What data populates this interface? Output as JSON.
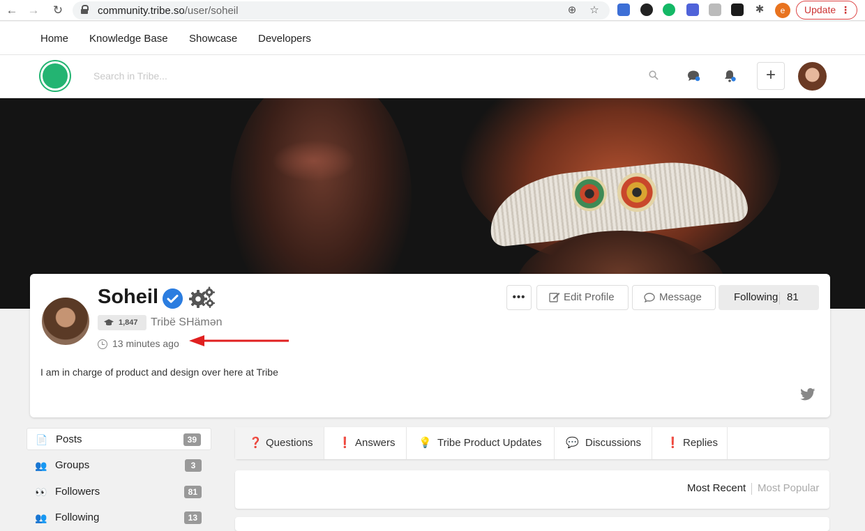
{
  "browser": {
    "url_host": "community.tribe.so",
    "url_path": "/user/soheil",
    "profile_initial": "e",
    "update_label": "Update",
    "update_menu": "⋮"
  },
  "site_nav": {
    "items": [
      {
        "label": "Home"
      },
      {
        "label": "Knowledge Base"
      },
      {
        "label": "Showcase"
      },
      {
        "label": "Developers"
      }
    ]
  },
  "header": {
    "search_placeholder": "Search in Tribe...",
    "add_label": "+"
  },
  "profile": {
    "name": "Soheil",
    "reputation": "1,847",
    "title": "Tribë SHämən",
    "last_seen": "13 minutes ago",
    "bio": "I am in charge of product and design over here at Tribe",
    "more_label": "•••",
    "edit_label": "Edit Profile",
    "message_label": "Message",
    "following_label": "Following",
    "following_count": "81"
  },
  "sidebar": {
    "items": [
      {
        "label": "Posts",
        "count": "39",
        "icon": "📄"
      },
      {
        "label": "Groups",
        "count": "3",
        "icon": "👥"
      },
      {
        "label": "Followers",
        "count": "81",
        "icon": "👀"
      },
      {
        "label": "Following",
        "count": "13",
        "icon": "👥"
      }
    ]
  },
  "tabs": {
    "items": [
      {
        "label": "Questions",
        "icon": "❓"
      },
      {
        "label": "Answers",
        "icon": "❗"
      },
      {
        "label": "Tribe Product Updates",
        "icon": "💡"
      },
      {
        "label": "Discussions",
        "icon": "💬"
      },
      {
        "label": "Replies",
        "icon": "❗"
      }
    ]
  },
  "sort": {
    "recent": "Most Recent",
    "popular": "Most Popular"
  },
  "colors": {
    "brand_green": "#23b472",
    "verified_blue": "#2b7de0",
    "annotation_red": "#e02020"
  }
}
